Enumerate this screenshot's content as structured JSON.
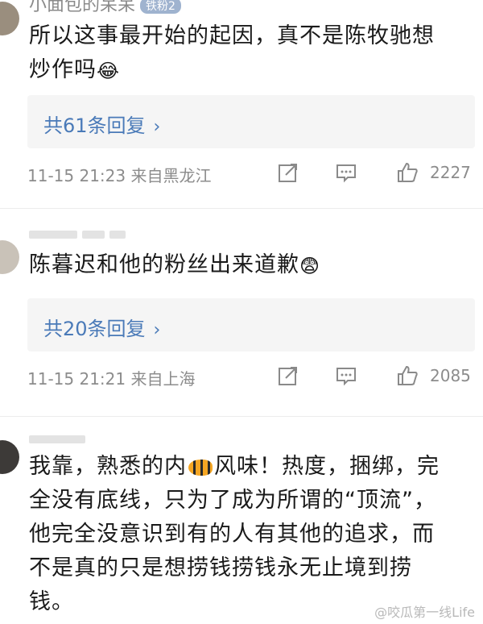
{
  "comments": [
    {
      "username": "小面包的呆呆",
      "badge": "铁粉2",
      "content_line1": "所以这事最开始的起因，真不是陈牧驰想",
      "content_line2": "炒作吗",
      "emoji": "😂",
      "reply_label": "共61条回复",
      "timestamp": "11-15 21:23 来自黑龙江",
      "likes": "2227"
    },
    {
      "content": "陈暮迟和他的粉丝出来道歉",
      "emoji": "😨",
      "reply_label": "共20条回复",
      "timestamp": "11-15 21:21 来自上海",
      "likes": "2085"
    },
    {
      "content_line1_pre": "我靠，熟悉的内",
      "content_line1_post": "风味！热度，捆绑，完",
      "content_line2": "全没有底线，只为了成为所谓的“顶流”，",
      "content_line3": "他完全没意识到有的人有其他的追求，而",
      "content_line4": "不是真的只是想捞钱捞钱永无止境到捞",
      "content_line5": "钱。"
    }
  ],
  "icons": {
    "share": "edit-share-icon",
    "comment": "comment-icon",
    "like": "thumbs-up-icon",
    "chevron": "chevron-right-icon"
  },
  "colors": {
    "reply_link": "#4a7ab8",
    "reply_bg": "#f5f5f5",
    "meta_text": "#8c8c8c"
  },
  "watermark": "@咬瓜第一线Life"
}
